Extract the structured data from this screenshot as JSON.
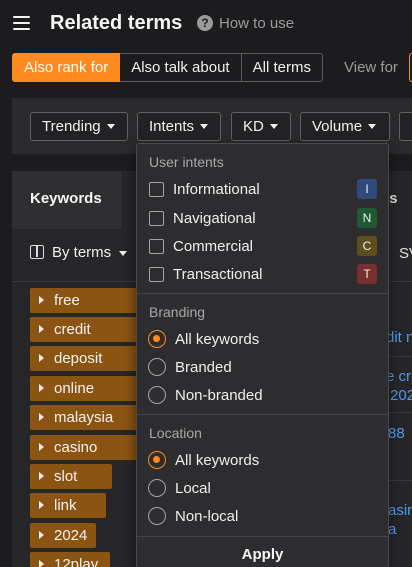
{
  "header": {
    "title": "Related terms",
    "help_label": "How to use"
  },
  "mode_tabs": [
    {
      "label": "Also rank for",
      "active": true
    },
    {
      "label": "Also talk about",
      "active": false
    },
    {
      "label": "All terms",
      "active": false
    }
  ],
  "view_for_label": "View for",
  "filters": [
    "Trending",
    "Intents",
    "KD",
    "Volume"
  ],
  "panel": {
    "keywords_tab": "Keywords",
    "right_header_fragment": "ters",
    "by_terms_label": "By terms",
    "sv_header_fragment": "SV"
  },
  "keywords": [
    "free",
    "credit",
    "deposit",
    "online",
    "malaysia",
    "casino",
    "slot",
    "link",
    "2024",
    "12play"
  ],
  "right_fragments": [
    "dit n",
    "e cre",
    "202",
    "88",
    "asin",
    "a"
  ],
  "dropdown": {
    "user_intents_heading": "User intents",
    "intents": [
      {
        "label": "Informational",
        "badge": "I",
        "badge_color": "#2e4a7a"
      },
      {
        "label": "Navigational",
        "badge": "N",
        "badge_color": "#1f5a33"
      },
      {
        "label": "Commercial",
        "badge": "C",
        "badge_color": "#5e4d1e"
      },
      {
        "label": "Transactional",
        "badge": "T",
        "badge_color": "#7a2e2e"
      }
    ],
    "branding_heading": "Branding",
    "branding": [
      {
        "label": "All keywords",
        "checked": true
      },
      {
        "label": "Branded",
        "checked": false
      },
      {
        "label": "Non-branded",
        "checked": false
      }
    ],
    "location_heading": "Location",
    "location": [
      {
        "label": "All keywords",
        "checked": true
      },
      {
        "label": "Local",
        "checked": false
      },
      {
        "label": "Non-local",
        "checked": false
      }
    ],
    "apply_label": "Apply"
  },
  "colors": {
    "accent": "#ff8a1f",
    "keyword_bar": "#8b5412",
    "link": "#4e9bf2"
  }
}
